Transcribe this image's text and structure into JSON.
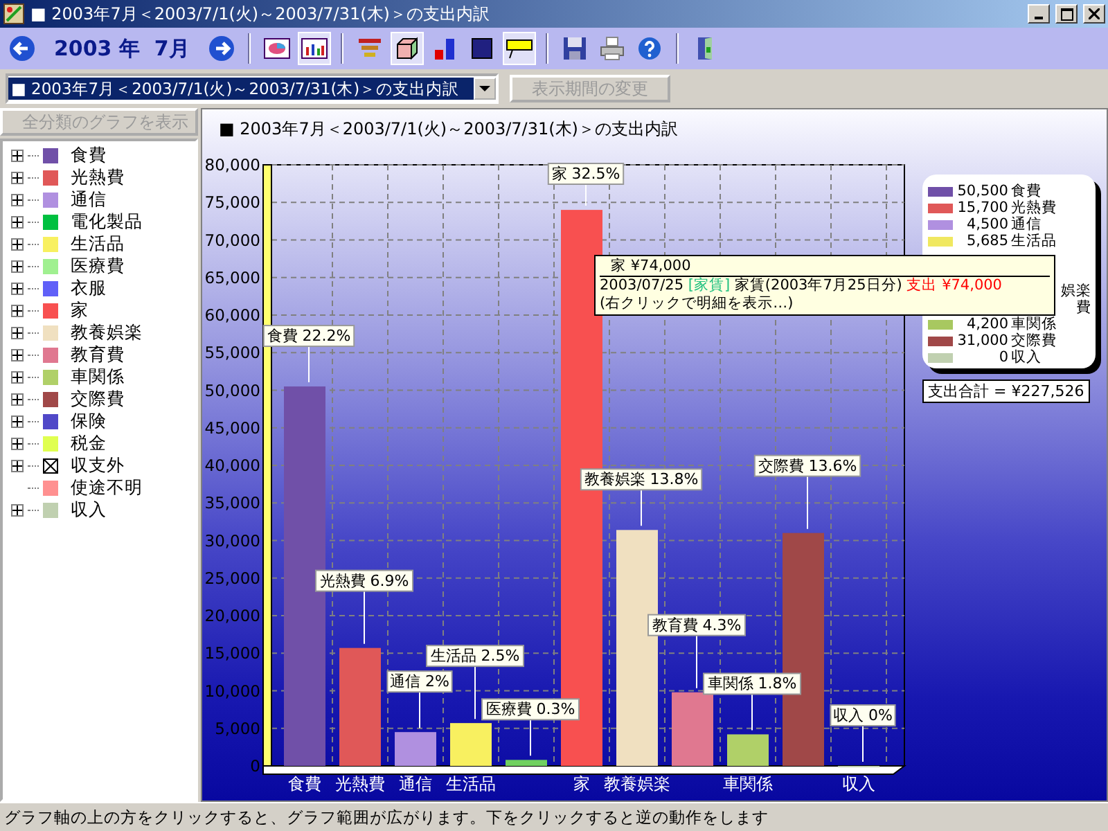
{
  "window": {
    "title": "■ 2003年7月＜2003/7/1(火)～2003/7/31(木)＞の支出内訳"
  },
  "toolbar": [
    {
      "kind": "prev"
    },
    {
      "kind": "label",
      "text": "2003 年  7月"
    },
    {
      "kind": "next"
    },
    {
      "kind": "sep"
    },
    {
      "kind": "pie",
      "pressed": false
    },
    {
      "kind": "bar",
      "pressed": true
    },
    {
      "kind": "sep"
    },
    {
      "kind": "funnel",
      "pressed": false
    },
    {
      "kind": "cube",
      "pressed": true
    },
    {
      "kind": "bars",
      "pressed": false
    },
    {
      "kind": "square",
      "pressed": false
    },
    {
      "kind": "note",
      "pressed": true
    },
    {
      "kind": "sep"
    },
    {
      "kind": "save",
      "pressed": false
    },
    {
      "kind": "print",
      "pressed": false
    },
    {
      "kind": "help",
      "pressed": false
    },
    {
      "kind": "sep"
    },
    {
      "kind": "exit",
      "pressed": false
    }
  ],
  "period_select": {
    "value": "■ 2003年7月＜2003/7/1(火)～2003/7/31(木)＞の支出内訳"
  },
  "change_period_button": {
    "label": "表示期間の変更",
    "disabled": true
  },
  "sidebar": {
    "all_button": {
      "label": "全分類のグラフを表示",
      "disabled": true
    },
    "items": [
      {
        "kind": "category",
        "label": "食費",
        "color": "#7050a8",
        "expandable": true
      },
      {
        "kind": "category",
        "label": "光熱費",
        "color": "#e05858",
        "expandable": true
      },
      {
        "kind": "category",
        "label": "通信",
        "color": "#b090e0",
        "expandable": true
      },
      {
        "kind": "category",
        "label": "電化製品",
        "color": "#00c040",
        "expandable": true
      },
      {
        "kind": "category",
        "label": "生活品",
        "color": "#f8f060",
        "expandable": true
      },
      {
        "kind": "category",
        "label": "医療費",
        "color": "#a0f090",
        "expandable": true
      },
      {
        "kind": "category",
        "label": "衣服",
        "color": "#6060f8",
        "expandable": true
      },
      {
        "kind": "category",
        "label": "家",
        "color": "#f85050",
        "expandable": true
      },
      {
        "kind": "category",
        "label": "教養娯楽",
        "color": "#f0e0c0",
        "expandable": true
      },
      {
        "kind": "category",
        "label": "教育費",
        "color": "#e07890",
        "expandable": true
      },
      {
        "kind": "category",
        "label": "車関係",
        "color": "#b0d068",
        "expandable": true
      },
      {
        "kind": "category",
        "label": "交際費",
        "color": "#a04848",
        "expandable": true
      },
      {
        "kind": "category",
        "label": "保険",
        "color": "#5048c8",
        "expandable": true
      },
      {
        "kind": "category",
        "label": "税金",
        "color": "#e0ff50",
        "expandable": true
      },
      {
        "kind": "excluded",
        "label": "収支外",
        "expandable": true
      },
      {
        "kind": "category",
        "label": "使途不明",
        "color": "#ff9090",
        "expandable": false
      },
      {
        "kind": "category",
        "label": "収入",
        "color": "#c0d0b0",
        "expandable": true
      }
    ]
  },
  "chart": {
    "title": "■ 2003年7月＜2003/7/1(火)～2003/7/31(木)＞の支出内訳",
    "chart_data": {
      "type": "bar",
      "categories": [
        "食費",
        "光熱費",
        "通信",
        "生活品",
        null,
        "家",
        "教養娯楽",
        null,
        "車関係",
        null,
        "収入"
      ],
      "values": [
        50500,
        15700,
        4500,
        5700,
        800,
        74000,
        31400,
        9800,
        4200,
        31000,
        0
      ],
      "colors": [
        "#7050a8",
        "#e05858",
        "#b090e0",
        "#f8f060",
        "#70d060",
        "#f85050",
        "#f0e0c0",
        "#e07890",
        "#b0d068",
        "#a04848",
        "#c0d0b0"
      ],
      "ylim": [
        0,
        80000
      ],
      "grid": true,
      "yticks": [
        {
          "value": 0,
          "label": "0"
        },
        {
          "value": 5000,
          "label": "5,000"
        },
        {
          "value": 10000,
          "label": "10,000"
        },
        {
          "value": 15000,
          "label": "15,000"
        },
        {
          "value": 20000,
          "label": "20,000"
        },
        {
          "value": 25000,
          "label": "25,000"
        },
        {
          "value": 30000,
          "label": "30,000"
        },
        {
          "value": 35000,
          "label": "35,000"
        },
        {
          "value": 40000,
          "label": "40,000"
        },
        {
          "value": 45000,
          "label": "45,000"
        },
        {
          "value": 50000,
          "label": "50,000"
        },
        {
          "value": 55000,
          "label": "55,000"
        },
        {
          "value": 60000,
          "label": "60,000"
        },
        {
          "value": 65000,
          "label": "65,000"
        },
        {
          "value": 70000,
          "label": "70,000"
        },
        {
          "value": 75000,
          "label": "75,000"
        },
        {
          "value": 80000,
          "label": "80,000"
        }
      ],
      "value_labels": [
        "食費 22.2%",
        "光熱費 6.9%",
        "通信 2%",
        "生活品 2.5%",
        "医療費 0.3%",
        "家 32.5%",
        "教養娯楽 13.8%",
        "教育費 4.3%",
        "車関係 1.8%",
        "交際費 13.6%",
        "収入 0%"
      ]
    },
    "legend": [
      {
        "kind": "full",
        "amount": "50,500",
        "name": "食費",
        "color": "#7050a8"
      },
      {
        "kind": "full",
        "amount": "15,700",
        "name": "光熱費",
        "color": "#e05858"
      },
      {
        "kind": "full",
        "amount": "4,500",
        "name": "通信",
        "color": "#b090e0"
      },
      {
        "kind": "full",
        "amount": "5,685",
        "name": "生活品",
        "color": "#f0e860"
      },
      {
        "kind": "covered"
      },
      {
        "kind": "covered"
      },
      {
        "kind": "partial",
        "name": "娯楽"
      },
      {
        "kind": "partial",
        "name": "費"
      },
      {
        "kind": "full",
        "amount": "4,200",
        "name": "車関係",
        "color": "#a8c860"
      },
      {
        "kind": "full",
        "amount": "31,000",
        "name": "交際費",
        "color": "#a04848"
      },
      {
        "kind": "full",
        "amount": "0",
        "name": "収入",
        "color": "#c0d0b0"
      }
    ],
    "total": "支出合計 = ¥227,526",
    "tooltip": {
      "title": "家 ¥74,000",
      "date": "2003/07/25",
      "tag": "[家賃]",
      "memo": "家賃(2003年7月25日分)",
      "amount": "支出 ¥74,000",
      "hint": "(右クリックで明細を表示…)"
    }
  },
  "status_bar": "グラフ軸の上の方をクリックすると、グラフ範囲が広がります。下をクリックすると逆の動作をします"
}
